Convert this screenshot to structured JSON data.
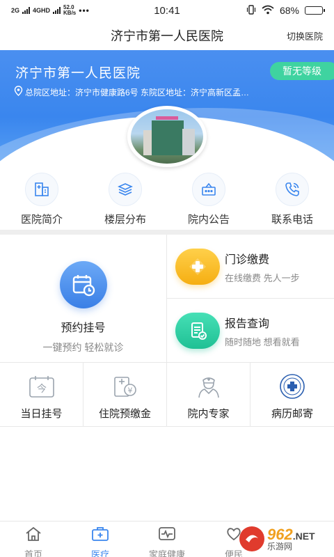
{
  "status_bar": {
    "network_left": "2G",
    "network_right": "4GHD",
    "speed": "52.0",
    "speed_unit": "KB/s",
    "dots": "•••",
    "time": "10:41",
    "battery_text": "68%",
    "battery_level": 0.68
  },
  "header": {
    "title": "济宁市第一人民医院",
    "switch_label": "切换医院"
  },
  "banner": {
    "hospital_name": "济宁市第一人民医院",
    "level_badge": "暂无等级",
    "address": "总院区地址：济宁市健康路6号 东院区地址：济宁高新区孟…"
  },
  "quick_links": [
    {
      "label": "医院简介",
      "icon": "hospital-building-icon"
    },
    {
      "label": "楼层分布",
      "icon": "layers-icon"
    },
    {
      "label": "院内公告",
      "icon": "notice-board-icon"
    },
    {
      "label": "联系电话",
      "icon": "phone-icon"
    }
  ],
  "services": {
    "appointment": {
      "title": "预约挂号",
      "subtitle": "一键预约 轻松就诊",
      "icon": "calendar-clock-icon"
    },
    "outpatient_payment": {
      "title": "门诊缴费",
      "subtitle": "在线缴费 先人一步",
      "icon": "plus-cross-icon"
    },
    "report_query": {
      "title": "报告查询",
      "subtitle": "随时随地 想看就看",
      "icon": "report-check-icon"
    },
    "small": [
      {
        "label": "当日挂号",
        "icon": "calendar-today-icon",
        "glyph": "今"
      },
      {
        "label": "住院预缴金",
        "icon": "deposit-icon",
        "glyph": "¥"
      },
      {
        "label": "院内专家",
        "icon": "doctor-icon"
      },
      {
        "label": "病历邮寄",
        "icon": "hospital-seal-icon"
      }
    ]
  },
  "bottom_nav": [
    {
      "label": "首页",
      "icon": "home-icon",
      "active": false
    },
    {
      "label": "医疗",
      "icon": "medical-kit-icon",
      "active": true
    },
    {
      "label": "家庭健康",
      "icon": "heart-monitor-icon",
      "active": false
    },
    {
      "label": "便民",
      "icon": "heart-hand-icon",
      "active": false
    }
  ],
  "watermark": {
    "number": "962",
    "suffix": ".NET",
    "site": "乐游网"
  },
  "colors": {
    "accent": "#3a86ee",
    "badge": "#3fd3a0",
    "orange": "#f5b521",
    "teal": "#2ec8a0"
  }
}
